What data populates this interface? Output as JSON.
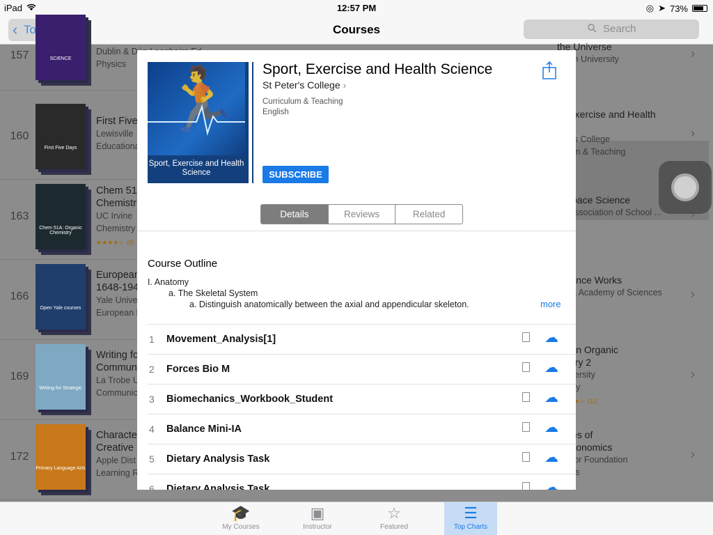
{
  "status": {
    "device": "iPad",
    "time": "12:57 PM",
    "battery": "73%"
  },
  "nav": {
    "back_label": "Top Charts",
    "title": "Courses",
    "search_placeholder": "Search"
  },
  "list": [
    {
      "rank": "157",
      "l1": "",
      "l2": "Dublin & Dún Laoghaire Ed...",
      "l3": "Physics",
      "cover_text": "SCIENCE",
      "cover_color": "#3a1f6e"
    },
    {
      "rank": "160",
      "l1": "First Five",
      "l2": "Lewisville",
      "l3": "Educationa",
      "cover_text": "First Five Days",
      "cover_color": "#2a2a2a"
    },
    {
      "rank": "163",
      "l1": "Chem 51A",
      "l2": "Chemistr",
      "l3": "UC Irvine",
      "l4": "Chemistry",
      "ratings": "(8)",
      "cover_text": "Chem 51A: Organic Chemistry",
      "cover_color": "#1c2a30"
    },
    {
      "rank": "166",
      "l1": "European",
      "l2": "1648-194",
      "l3": "Yale Unive",
      "l4": "European h",
      "cover_text": "Open Yale courses",
      "cover_color": "#1f3e6b"
    },
    {
      "rank": "169",
      "l1": "Writing fo",
      "l2": "Commun",
      "l3": "La Trobe U",
      "l4": "Communic",
      "cover_text": "Writing for Strategic",
      "cover_color": "#7fa9c2"
    },
    {
      "rank": "172",
      "l1": "Characte",
      "l2": "Creative",
      "l3": "Apple Dist",
      "l4": "Learning R",
      "cover_text": "Primary Language Arts",
      "cover_color": "#c8781a"
    }
  ],
  "right_column": [
    {
      "l1": "the Universe",
      "l2": "Open University",
      "l3": "nce"
    },
    {
      "l1": "rt, Exercise and Health",
      "l2": "nce",
      "l3": "eter's College",
      "l4": "culum & Teaching"
    },
    {
      "l1": "h/Space Science",
      "l2": "da Association of School ...",
      "l3": "nce"
    },
    {
      "l1": "Science Works",
      "l2": "ornia Academy of Sciences",
      "l3": "nce"
    },
    {
      "l1": "hman Organic",
      "l2": "mistry 2",
      "l3": "University",
      "l4": "mistry",
      "ratings": "(11)"
    },
    {
      "l1": "ciples of",
      "l2": "roeconomics",
      "l3": "Saylor Foundation",
      "l4": "omics"
    }
  ],
  "modal": {
    "title": "Sport, Exercise and Health Science",
    "author": "St Peter's College",
    "category": "Curriculum & Teaching",
    "language": "English",
    "cover_caption": "Sport, Exercise and Health Science",
    "subscribe_label": "SUBSCRIBE",
    "segments": [
      "Details",
      "Reviews",
      "Related"
    ],
    "outline_title": "Course Outline",
    "outline": [
      "I. Anatomy",
      "a. The Skeletal System",
      "a. Distinguish anatomically between the axial and appendicular skeleton."
    ],
    "more_label": "more",
    "items": [
      {
        "num": "1",
        "name": "Movement_Analysis[1]"
      },
      {
        "num": "2",
        "name": "Forces Bio M"
      },
      {
        "num": "3",
        "name": "Biomechanics_Workbook_Student"
      },
      {
        "num": "4",
        "name": "Balance Mini-IA"
      },
      {
        "num": "5",
        "name": "Dietary Analysis Task"
      },
      {
        "num": "6",
        "name": "Dietary Analysis Task"
      }
    ]
  },
  "tabs": [
    {
      "label": "My Courses",
      "icon": "graduation-cap-icon"
    },
    {
      "label": "Instructor",
      "icon": "instructor-icon"
    },
    {
      "label": "Featured",
      "icon": "star-icon"
    },
    {
      "label": "Top Charts",
      "icon": "list-icon"
    }
  ],
  "colors": {
    "accent": "#1a7ae6",
    "active_tab_bg": "#c6dcf5"
  }
}
